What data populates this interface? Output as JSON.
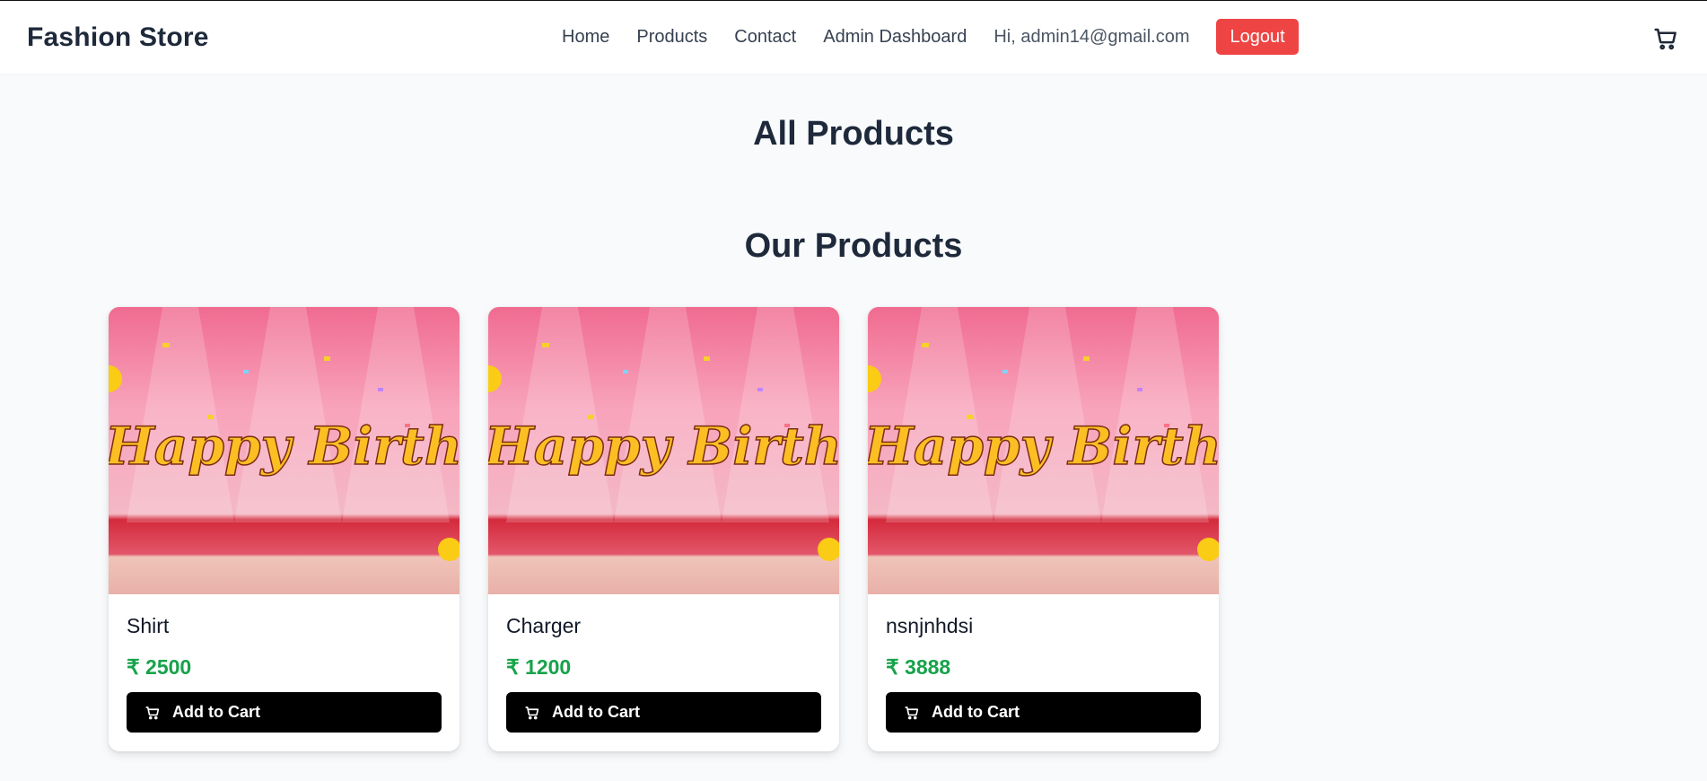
{
  "brand": "Fashion Store",
  "nav": {
    "links": [
      "Home",
      "Products",
      "Contact",
      "Admin Dashboard"
    ],
    "greeting": "Hi, admin14@gmail.com",
    "logout_label": "Logout",
    "cart_icon": "cart-icon"
  },
  "page_title": "All Products",
  "section_title": "Our Products",
  "products": [
    {
      "name": "Shirt",
      "price": "₹ 2500",
      "button_label": "Add to Cart",
      "image_text": "Happy Birthday"
    },
    {
      "name": "Charger",
      "price": "₹ 1200",
      "button_label": "Add to Cart",
      "image_text": "Happy Birthday"
    },
    {
      "name": "nsnjnhdsi",
      "price": "₹ 3888",
      "button_label": "Add to Cart",
      "image_text": "Happy Birthday"
    }
  ],
  "colors": {
    "logout_bg": "#ef4444",
    "price": "#16a34a",
    "button_bg": "#000000",
    "page_bg": "#f8fafc"
  }
}
